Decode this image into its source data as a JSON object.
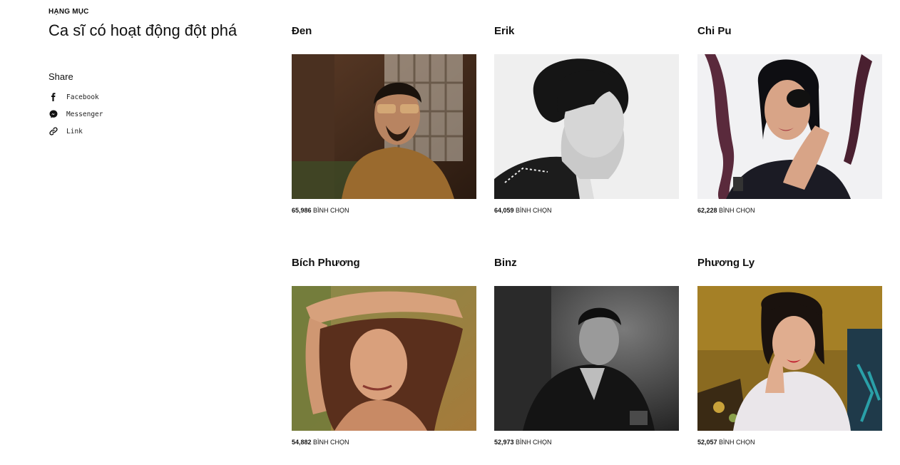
{
  "category": {
    "label": "HẠNG MỤC",
    "title": "Ca sĩ có hoạt động đột phá"
  },
  "share": {
    "title": "Share",
    "items": [
      {
        "label": "Facebook",
        "icon": "facebook-icon"
      },
      {
        "label": "Messenger",
        "icon": "messenger-icon"
      },
      {
        "label": "Link",
        "icon": "link-icon"
      }
    ]
  },
  "votes_suffix": "BÌNH CHỌN",
  "nominees": [
    {
      "name": "Đen",
      "votes": "65,986",
      "votes_suffix": "BÌNH CHỌN",
      "photo": "portrait-glasses-brown-tones"
    },
    {
      "name": "Erik",
      "votes": "64,059",
      "votes_suffix": "BÌNH CHỌN",
      "photo": "portrait-profile-bw"
    },
    {
      "name": "Chi Pu",
      "votes": "62,228",
      "votes_suffix": "BÌNH CHỌN",
      "photo": "portrait-covering-eye"
    },
    {
      "name": "Bích Phương",
      "votes": "54,882",
      "votes_suffix": "BÌNH CHỌN",
      "photo": "portrait-warm-arm-raised"
    },
    {
      "name": "Binz",
      "votes": "52,973",
      "votes_suffix": "BÌNH CHỌN",
      "photo": "portrait-suit-bw"
    },
    {
      "name": "Phương Ly",
      "votes": "52,057",
      "votes_suffix": "BÌNH CHỌN",
      "photo": "portrait-colorful-floral"
    }
  ]
}
